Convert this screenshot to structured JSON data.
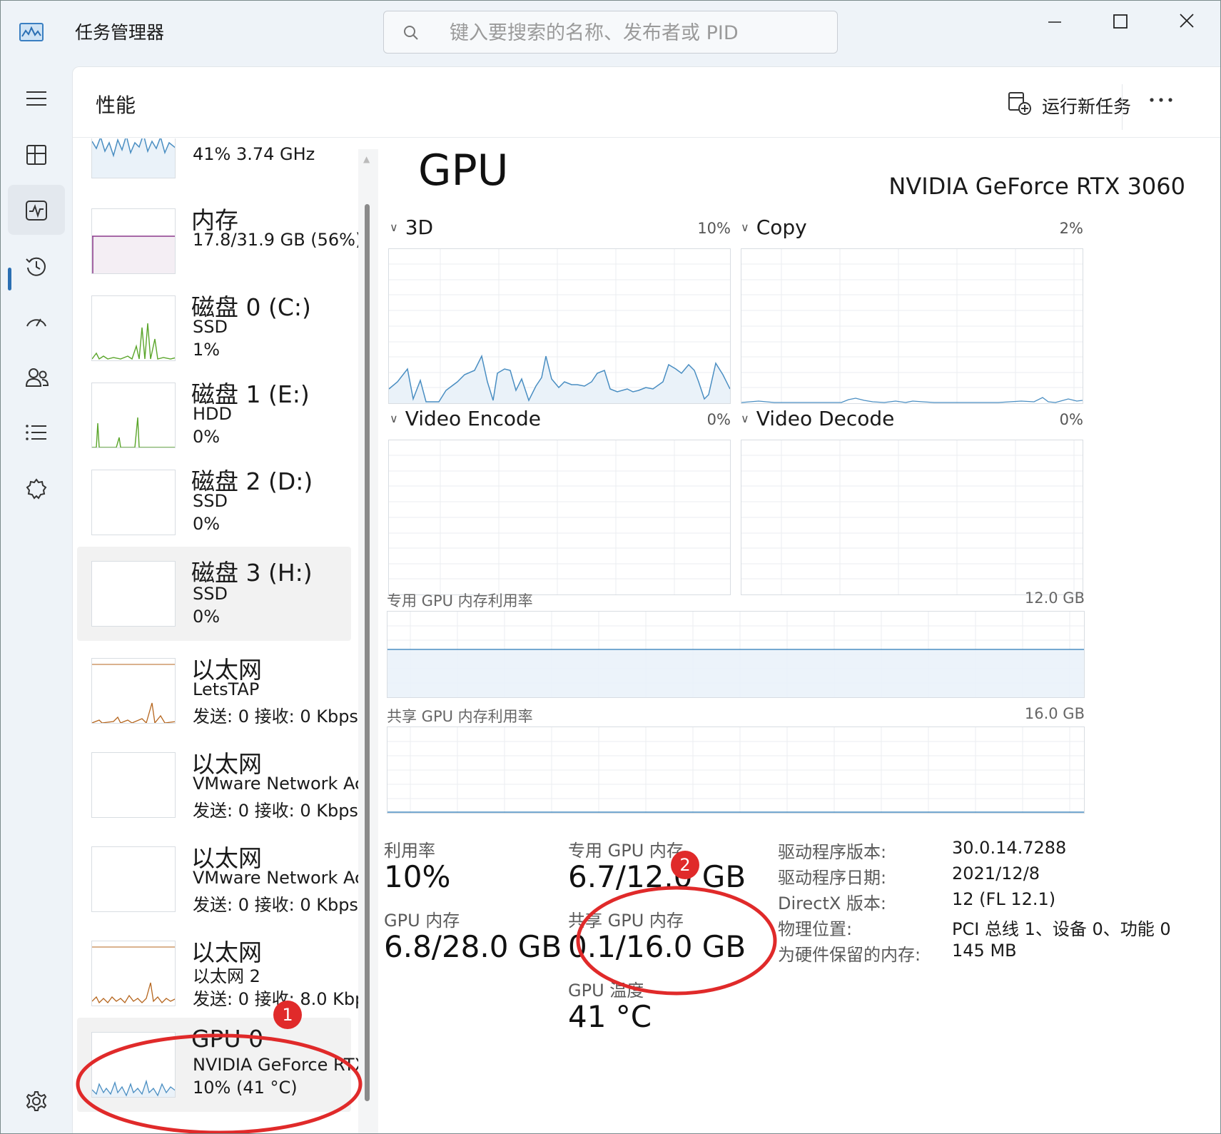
{
  "window": {
    "title": "任务管理器",
    "search_placeholder": "键入要搜索的名称、发布者或 PID"
  },
  "nav": {
    "items": [
      "menu-icon",
      "processes-icon",
      "performance-icon",
      "app-history-icon",
      "startup-icon",
      "users-icon",
      "details-icon",
      "services-icon",
      "settings-icon"
    ],
    "active": "performance"
  },
  "header": {
    "title": "性能",
    "run_task_label": "运行新任务"
  },
  "devices": [
    {
      "title": "",
      "line1": "41% 3.74 GHz",
      "line2": ""
    },
    {
      "title": "内存",
      "line1": "17.8/31.9 GB (56%)",
      "line2": ""
    },
    {
      "title": "磁盘 0 (C:)",
      "line1": "SSD",
      "line2": "1%"
    },
    {
      "title": "磁盘 1 (E:)",
      "line1": "HDD",
      "line2": "0%"
    },
    {
      "title": "磁盘 2 (D:)",
      "line1": "SSD",
      "line2": "0%"
    },
    {
      "title": "磁盘 3 (H:)",
      "line1": "SSD",
      "line2": "0%"
    },
    {
      "title": "以太网",
      "line1": "LetsTAP",
      "line2": "发送: 0 接收: 0 Kbps"
    },
    {
      "title": "以太网",
      "line1": "VMware Network Ac",
      "line2": "发送: 0 接收: 0 Kbps"
    },
    {
      "title": "以太网",
      "line1": "VMware Network Ac",
      "line2": "发送: 0 接收: 0 Kbps"
    },
    {
      "title": "以太网",
      "line1": "以太网 2",
      "line2": "发送: 0 接收: 8.0 Kbp"
    },
    {
      "title": "GPU 0",
      "line1": "NVIDIA GeForce RTX",
      "line2": "10% (41 °C)"
    }
  ],
  "detail": {
    "heading": "GPU",
    "model": "NVIDIA GeForce RTX 3060",
    "engines": [
      {
        "name": "3D",
        "percent": "10%"
      },
      {
        "name": "Copy",
        "percent": "2%"
      },
      {
        "name": "Video Encode",
        "percent": "0%"
      },
      {
        "name": "Video Decode",
        "percent": "0%"
      }
    ],
    "dedicated_mem_graph": {
      "label": "专用 GPU 内存利用率",
      "max": "12.0 GB"
    },
    "shared_mem_graph": {
      "label": "共享 GPU 内存利用率",
      "max": "16.0 GB"
    },
    "stats": {
      "utilization_label": "利用率",
      "utilization_value": "10%",
      "gpu_mem_label": "GPU 内存",
      "gpu_mem_value": "6.8/28.0 GB",
      "dedicated_label": "专用 GPU 内存",
      "dedicated_value": "6.7/12.0 GB",
      "shared_label": "共享 GPU 内存",
      "shared_value": "0.1/16.0 GB",
      "temp_label": "GPU 温度",
      "temp_value": "41 °C"
    },
    "info": [
      {
        "label": "驱动程序版本:",
        "value": "30.0.14.7288"
      },
      {
        "label": "驱动程序日期:",
        "value": "2021/12/8"
      },
      {
        "label": "DirectX 版本:",
        "value": "12 (FL 12.1)"
      },
      {
        "label": "物理位置:",
        "value": "PCI 总线 1、设备 0、功能 0"
      },
      {
        "label": "为硬件保留的内存:",
        "value": "145 MB"
      }
    ]
  },
  "annotations": {
    "marker1": "1",
    "marker2": "2",
    "color": "#e02a2a"
  },
  "colors": {
    "gpu_line": "#4a8ec2",
    "gpu_fill": "#eaf2f9",
    "disk_line": "#5aa52a",
    "net_line": "#b5651d",
    "mem_line": "#8b3a8b",
    "accent": "#2b6fb3"
  }
}
